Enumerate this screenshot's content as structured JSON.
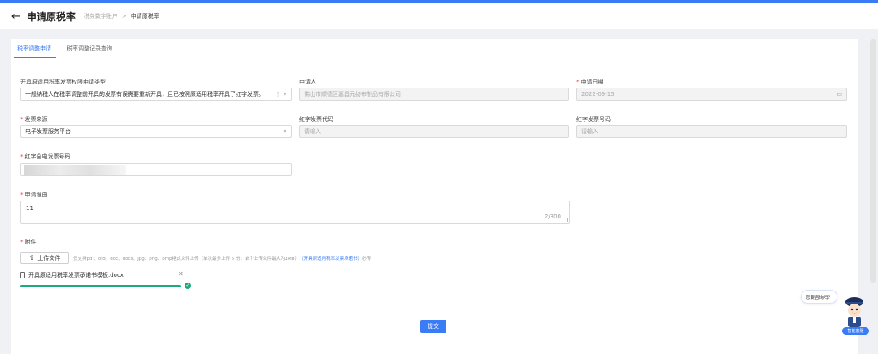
{
  "header": {
    "back_icon": "arrow-left-icon",
    "title": "申请原税率",
    "breadcrumb_parent": "税务数字账户",
    "breadcrumb_separator": ">",
    "breadcrumb_current": "申请原税率"
  },
  "tabs": [
    {
      "label": "税率调整申请",
      "active": true
    },
    {
      "label": "税率调整记录查询",
      "active": false
    }
  ],
  "form": {
    "apply_type": {
      "label": "开具原适用税率发票权限申请类型",
      "value": "一般纳税人在税率调整前开具的发票有误需要重新开具，且已按照原适用税率开具了红字发票。",
      "suffix": "⋮ ∨"
    },
    "applicant": {
      "label": "申请人",
      "value": "佛山市顺德区嘉昌元纺布制品有限公司"
    },
    "apply_date": {
      "label": "申请日期",
      "value": "2022-09-15",
      "icon": "calendar-icon"
    },
    "invoice_source": {
      "label": "发票来源",
      "value": "电子发票服务平台",
      "icon": "chevron-down-icon"
    },
    "red_invoice_code": {
      "label": "红字发票代码",
      "placeholder": "请输入"
    },
    "red_invoice_number": {
      "label": "红字发票号码",
      "placeholder": "请输入"
    },
    "red_full_invoice_number": {
      "label": "红字全电发票号码"
    },
    "reason": {
      "label": "申请理由",
      "value": "11",
      "counter": "2/300"
    },
    "attachment": {
      "label": "附件",
      "upload_label": "上传文件",
      "hint_prefix": "仅支持pdf、ofd、doc、docx、jpg、png、bmp格式文件上传（单次最多上传 5 份，单个上传文件最大为1MB），",
      "hint_link": "《开具原适用税率发票承诺书》",
      "hint_suffix": "必传",
      "file_name": "开具原适用税率发票承诺书模板.docx",
      "progress_percent": 100
    }
  },
  "submit_label": "提交",
  "assistant": {
    "bubble_text": "您要咨询吗？",
    "badge_text": "智能客服"
  },
  "colors": {
    "primary": "#3a7cf5",
    "success": "#1ea97c",
    "required": "#e54545"
  }
}
